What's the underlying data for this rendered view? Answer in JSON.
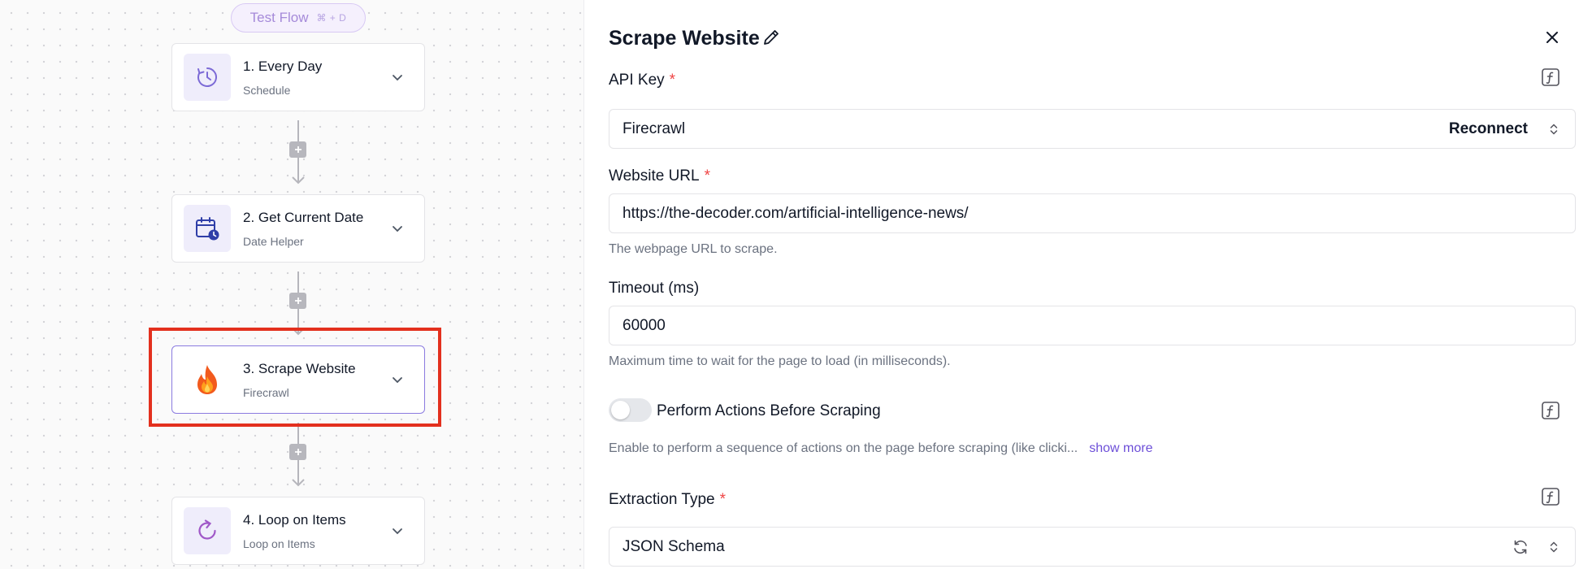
{
  "flow": {
    "test_flow": {
      "label": "Test Flow",
      "shortcut": "⌘ + D"
    },
    "steps": [
      {
        "title": "1. Every Day",
        "subtitle": "Schedule",
        "icon": "schedule-clock-icon"
      },
      {
        "title": "2. Get Current Date",
        "subtitle": "Date Helper",
        "icon": "calendar-clock-icon"
      },
      {
        "title": "3. Scrape Website",
        "subtitle": "Firecrawl",
        "icon": "fire-icon",
        "selected": true
      },
      {
        "title": "4. Loop on Items",
        "subtitle": "Loop on Items",
        "icon": "loop-icon"
      }
    ]
  },
  "panel": {
    "title": "Scrape Website",
    "api_key": {
      "label": "API Key",
      "required": "*",
      "value": "Firecrawl",
      "action": "Reconnect"
    },
    "website_url": {
      "label": "Website URL",
      "required": "*",
      "value": "https://the-decoder.com/artificial-intelligence-news/",
      "help": "The webpage URL to scrape."
    },
    "timeout": {
      "label": "Timeout (ms)",
      "value": "60000",
      "help": "Maximum time to wait for the page to load (in milliseconds)."
    },
    "perform_actions": {
      "label": "Perform Actions Before Scraping",
      "enabled": false,
      "help": "Enable to perform a sequence of actions on the page before scraping (like clicki...",
      "show_more": "show more"
    },
    "extraction_type": {
      "label": "Extraction Type",
      "required": "*",
      "value": "JSON Schema"
    }
  },
  "colors": {
    "accent": "#6d4fd8",
    "highlight": "#e3301e",
    "required": "#ef4444"
  }
}
